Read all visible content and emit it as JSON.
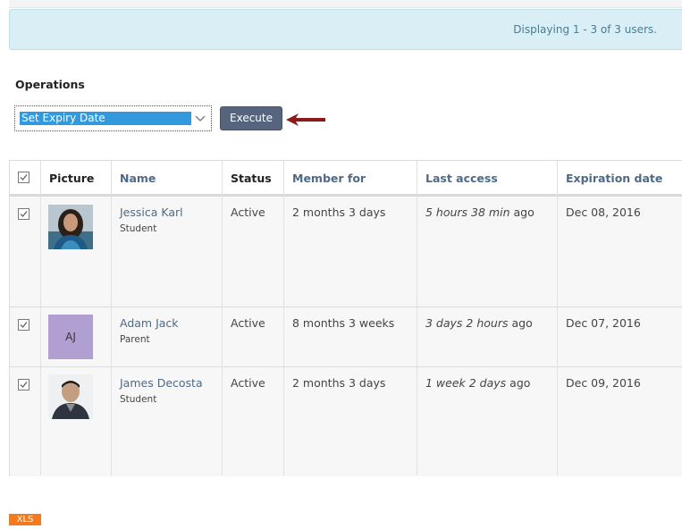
{
  "info": {
    "message": "Displaying 1 - 3 of 3 users."
  },
  "operations": {
    "label": "Operations",
    "selected": "Set Expiry Date",
    "execute_label": "Execute"
  },
  "table": {
    "headers": {
      "picture": "Picture",
      "name": "Name",
      "status": "Status",
      "member_for": "Member for",
      "last_access": "Last access",
      "expiration": "Expiration date"
    },
    "rows": [
      {
        "checked": true,
        "name": "Jessica Karl",
        "role": "Student",
        "avatar": "photo-woman",
        "initials": "",
        "status": "Active",
        "member_for": "2 months 3 days",
        "last_access": "5 hours 38 min",
        "last_access_suffix": "ago",
        "expiration": "Dec 08, 2016"
      },
      {
        "checked": true,
        "name": "Adam Jack",
        "role": "Parent",
        "avatar": "initials",
        "initials": "AJ",
        "status": "Active",
        "member_for": "8 months 3 weeks",
        "last_access": "3 days 2 hours",
        "last_access_suffix": "ago",
        "expiration": "Dec 07, 2016"
      },
      {
        "checked": true,
        "name": "James Decosta",
        "role": "Student",
        "avatar": "photo-man",
        "initials": "",
        "status": "Active",
        "member_for": "2 months 3 days",
        "last_access": "1 week 2 days",
        "last_access_suffix": "ago",
        "expiration": "Dec 09, 2016"
      }
    ]
  },
  "export": {
    "xls_label": "XLS"
  },
  "colors": {
    "info_bg": "#d9eef5",
    "button": "#56647e",
    "arrow": "#8b1a1a",
    "link": "#4e6a87",
    "xls": "#f47a20",
    "avatar_initials_bg": "#b19fd2"
  }
}
